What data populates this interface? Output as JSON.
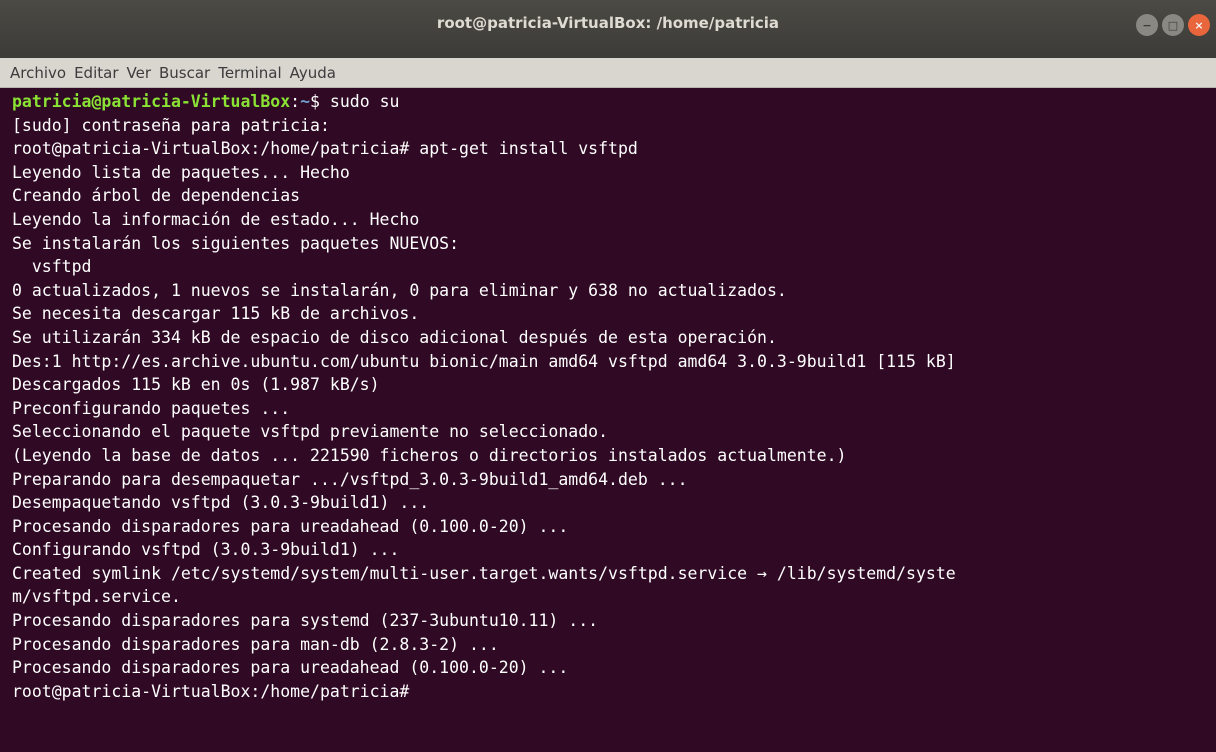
{
  "window": {
    "title": "root@patricia-VirtualBox: /home/patricia",
    "controls": {
      "minimize": "−",
      "maximize": "□",
      "close": "×"
    }
  },
  "menubar": [
    "Archivo",
    "Editar",
    "Ver",
    "Buscar",
    "Terminal",
    "Ayuda"
  ],
  "terminal": {
    "first_prompt": {
      "user_host": "patricia@patricia-VirtualBox",
      "sep": ":",
      "path": "~",
      "symbol": "$",
      "command": " sudo su"
    },
    "lines": [
      "[sudo] contraseña para patricia:",
      "root@patricia-VirtualBox:/home/patricia# apt-get install vsftpd",
      "Leyendo lista de paquetes... Hecho",
      "Creando árbol de dependencias",
      "Leyendo la información de estado... Hecho",
      "Se instalarán los siguientes paquetes NUEVOS:",
      "  vsftpd",
      "0 actualizados, 1 nuevos se instalarán, 0 para eliminar y 638 no actualizados.",
      "Se necesita descargar 115 kB de archivos.",
      "Se utilizarán 334 kB de espacio de disco adicional después de esta operación.",
      "Des:1 http://es.archive.ubuntu.com/ubuntu bionic/main amd64 vsftpd amd64 3.0.3-9build1 [115 kB]",
      "Descargados 115 kB en 0s (1.987 kB/s)",
      "Preconfigurando paquetes ...",
      "Seleccionando el paquete vsftpd previamente no seleccionado.",
      "(Leyendo la base de datos ... 221590 ficheros o directorios instalados actualmente.)",
      "Preparando para desempaquetar .../vsftpd_3.0.3-9build1_amd64.deb ...",
      "Desempaquetando vsftpd (3.0.3-9build1) ...",
      "Procesando disparadores para ureadahead (0.100.0-20) ...",
      "Configurando vsftpd (3.0.3-9build1) ...",
      "Created symlink /etc/systemd/system/multi-user.target.wants/vsftpd.service → /lib/systemd/syste",
      "m/vsftpd.service.",
      "Procesando disparadores para systemd (237-3ubuntu10.11) ...",
      "Procesando disparadores para man-db (2.8.3-2) ...",
      "Procesando disparadores para ureadahead (0.100.0-20) ...",
      "root@patricia-VirtualBox:/home/patricia# "
    ]
  }
}
